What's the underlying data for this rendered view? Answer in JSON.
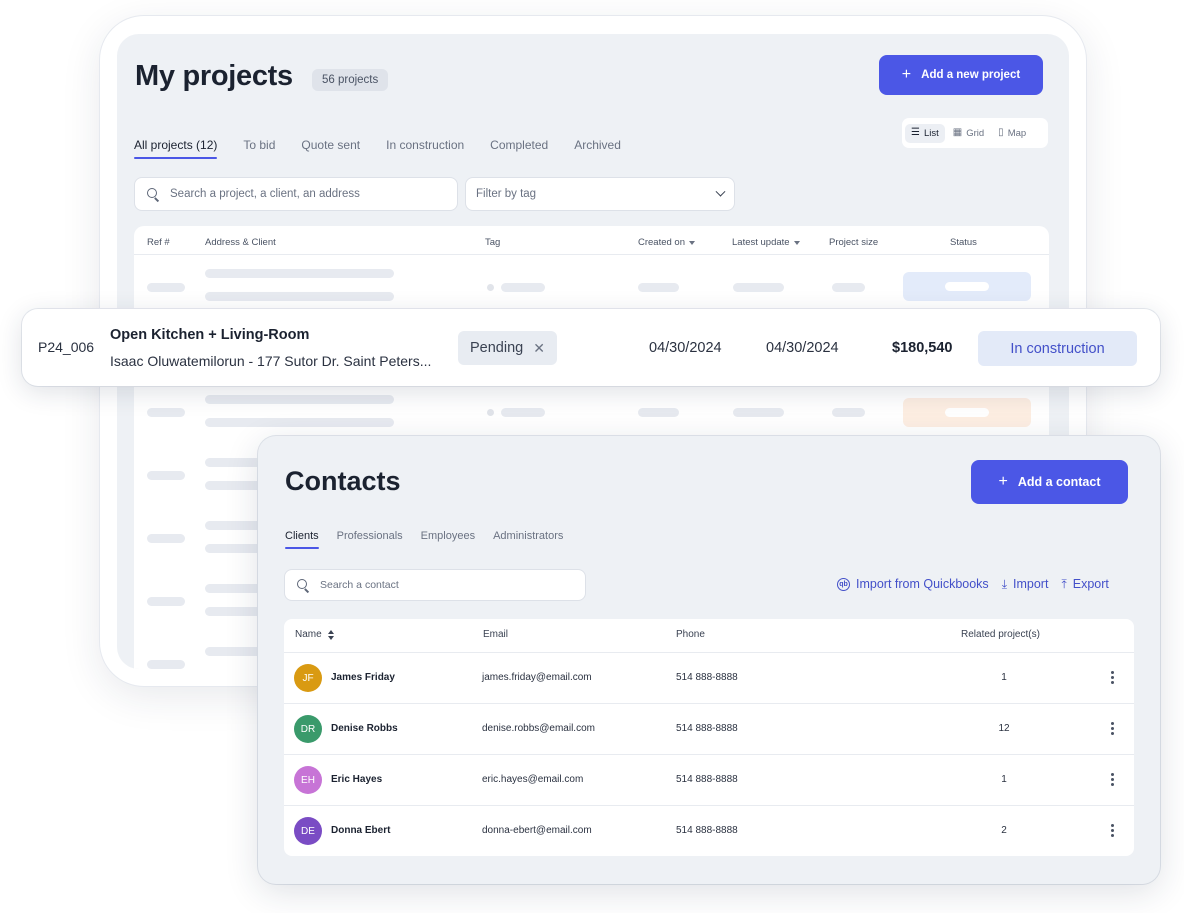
{
  "projects": {
    "title": "My projects",
    "count_badge": "56 projects",
    "add_button": "Add a new project",
    "tabs": [
      {
        "label": "All projects (12)",
        "active": true
      },
      {
        "label": "To bid"
      },
      {
        "label": "Quote sent"
      },
      {
        "label": "In construction"
      },
      {
        "label": "Completed"
      },
      {
        "label": "Archived"
      }
    ],
    "view_toggle": [
      {
        "label": "List",
        "icon": "list-icon",
        "active": true
      },
      {
        "label": "Grid",
        "icon": "grid-icon"
      },
      {
        "label": "Map",
        "icon": "map-icon"
      }
    ],
    "search_placeholder": "Search a project, a client, an address",
    "tag_filter_placeholder": "Filter by tag",
    "columns": {
      "ref": "Ref #",
      "address_client": "Address & Client",
      "tag": "Tag",
      "created_on": "Created on",
      "latest_update": "Latest update",
      "project_size": "Project size",
      "status": "Status"
    },
    "highlighted_row": {
      "ref": "P24_006",
      "title": "Open Kitchen + Living-Room",
      "subtitle": "Isaac Oluwatemilorun - 177 Sutor Dr. Saint Peters...",
      "tag": "Pending",
      "created_on": "04/30/2024",
      "latest_update": "04/30/2024",
      "project_size": "$180,540",
      "status": "In construction"
    },
    "skeleton_status_colors": [
      "#e3ebfa",
      "#fdeee2"
    ]
  },
  "contacts": {
    "title": "Contacts",
    "add_button": "Add a contact",
    "tabs": [
      {
        "label": "Clients",
        "active": true
      },
      {
        "label": "Professionals"
      },
      {
        "label": "Employees"
      },
      {
        "label": "Administrators"
      }
    ],
    "search_placeholder": "Search a contact",
    "actions": {
      "quickbooks": "Import from Quickbooks",
      "import": "Import",
      "export": "Export"
    },
    "columns": {
      "name": "Name",
      "email": "Email",
      "phone": "Phone",
      "related": "Related project(s)"
    },
    "rows": [
      {
        "initials": "JF",
        "name": "James Friday",
        "email": "james.friday@email.com",
        "phone": "514 888-8888",
        "related": "1",
        "color": "#d99a12"
      },
      {
        "initials": "DR",
        "name": "Denise Robbs",
        "email": "denise.robbs@email.com",
        "phone": "514 888-8888",
        "related": "12",
        "color": "#3a9a6b"
      },
      {
        "initials": "EH",
        "name": "Eric Hayes",
        "email": "eric.hayes@email.com",
        "phone": "514 888-8888",
        "related": "1",
        "color": "#c774d6"
      },
      {
        "initials": "DE",
        "name": "Donna Ebert",
        "email": "donna-ebert@email.com",
        "phone": "514 888-8888",
        "related": "2",
        "color": "#7a4cc4"
      }
    ]
  },
  "colors": {
    "accent": "#4b57e6",
    "status_in_construction_bg": "#e3eaf8",
    "status_in_construction_text": "#4350c9"
  }
}
